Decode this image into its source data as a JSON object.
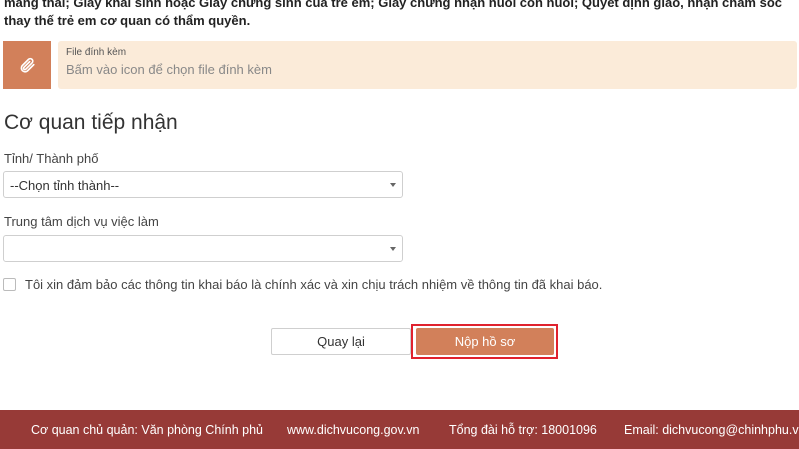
{
  "intro": {
    "text": "mang thai; Giấy khai sinh hoặc Giấy chứng sinh của trẻ em; Giấy chứng nhận nuôi con nuôi; Quyết định giao, nhận chăm sóc thay thế trẻ em cơ quan có thẩm quyền."
  },
  "attachment": {
    "icon": "paperclip-icon",
    "label": "File đính kèm",
    "placeholder": "Bấm vào icon để chọn file đính kèm"
  },
  "section": {
    "title": "Cơ quan tiếp nhận"
  },
  "province": {
    "label": "Tỉnh/ Thành phố",
    "selected": "--Chọn tỉnh thành--"
  },
  "employment_center": {
    "label": "Trung tâm dịch vụ việc làm",
    "selected": ""
  },
  "commitment": {
    "checked": false,
    "label": "Tôi xin đảm bảo các thông tin khai báo là chính xác và xin chịu trách nhiệm về thông tin đã khai báo."
  },
  "actions": {
    "back_label": "Quay lại",
    "submit_label": "Nộp hồ sơ"
  },
  "colors": {
    "accent": "#d2805a",
    "attachment_bg": "#fbebd9",
    "highlight": "#e0222e",
    "footer_bg": "#973a37"
  },
  "footer": {
    "agency": "Cơ quan chủ quản: Văn phòng Chính phủ",
    "website": "www.dichvucong.gov.vn",
    "hotline": "Tổng đài hỗ trợ: 18001096",
    "email": "Email: dichvucong@chinhphu.vn"
  }
}
